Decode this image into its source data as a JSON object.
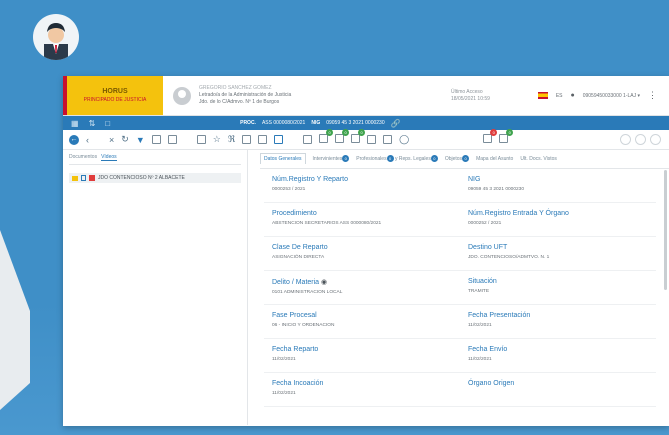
{
  "header": {
    "logo_title": "HORUS",
    "logo_sub": "PRINCIPADO DE JUSTICIA",
    "user_name": "GREGORIO SANCHEZ GOMEZ",
    "user_role": "Letrado/a de la Administración de Justicia",
    "user_court": "Jdo. de lo C/Admvo. Nº 1 de Burgos",
    "last_access_label": "Último Acceso",
    "last_access_value": "18/05/2021 10:59",
    "language": "ES",
    "user_id": "09059450033000 1-LAJ ▾"
  },
  "bluebar": {
    "proc_label": "PROC.",
    "proc_value": "ASS 0000080/2021",
    "nig_label": "NIG",
    "nig_value": "09059 45 3 2021 0000230"
  },
  "toolbar": {
    "badges": [
      "0",
      "0",
      "0",
      "0",
      "0"
    ]
  },
  "left": {
    "tab_documents": "Documentos",
    "tab_videos": "Vídeos",
    "tree_item": "JDO CONTENCIOSO Nº 2 ALBACETE"
  },
  "right": {
    "tabs": {
      "general": "Datos Generales",
      "intervinientes": "Intervinientes",
      "profesionales": "Profesionales",
      "rep_legales": "y Reps. Legales",
      "objetos": "Objetos",
      "mapa": "Mapa del Asunto",
      "ult_docs": "Ult. Docs. Vistos"
    },
    "tab_badges": [
      "0",
      "0",
      "0",
      "0"
    ],
    "fields": [
      {
        "label": "Núm.Registro Y Reparto",
        "value": "0000253 / 2021"
      },
      {
        "label": "NIG",
        "value": "09059 45 3 2021 0000230"
      },
      {
        "label": "Procedimiento",
        "value": "ABSTENCION SECRETARIOS ASS 0000080/2021"
      },
      {
        "label": "Núm.Registro Entrada Y Órgano",
        "value": "0000252 / 2021"
      },
      {
        "label": "Clase De Reparto",
        "value": "ASIGNACIÓN DIRECTA"
      },
      {
        "label": "Destino UFT",
        "value": "JDO. CONTENCIOSO/ADMTVO. N. 1"
      },
      {
        "label": "Delito / Materia",
        "value": "0101 ADMINISTRACION LOCAL"
      },
      {
        "label": "Situación",
        "value": "TRAMITE"
      },
      {
        "label": "Fase Procesal",
        "value": "06 - INICIO Y ORDENACION"
      },
      {
        "label": "Fecha Presentación",
        "value": "11/02/2021"
      },
      {
        "label": "Fecha Reparto",
        "value": "11/02/2021"
      },
      {
        "label": "Fecha Envío",
        "value": "11/02/2021"
      },
      {
        "label": "Fecha Incoación",
        "value": "11/02/2021"
      },
      {
        "label": "Órgano Origen",
        "value": ""
      }
    ]
  },
  "colors": {
    "accent": "#2a7ab8",
    "brand_yellow": "#f4c20d",
    "brand_red": "#c8102e",
    "background": "#3f8fc7"
  }
}
